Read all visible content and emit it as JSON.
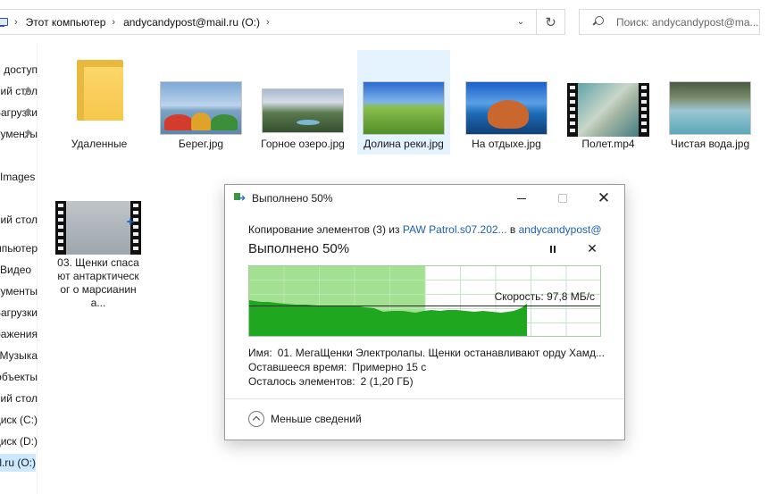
{
  "address": {
    "crumbs": [
      "Этот компьютер",
      "andycandypost@mail.ru (O:)"
    ],
    "search_placeholder": "Поиск: andycandypost@ma..."
  },
  "nav": {
    "items": [
      {
        "label": "Быстрый доступ"
      },
      {
        "label": "Рабочий стол"
      },
      {
        "label": "Загрузки"
      },
      {
        "label": "Документы"
      },
      {
        "label": "Images"
      },
      {
        "label": "Рабочий стол"
      },
      {
        "label": "Этот компьютер"
      },
      {
        "label": "Видео"
      },
      {
        "label": "Документы"
      },
      {
        "label": "Загрузки"
      },
      {
        "label": "Изображения"
      },
      {
        "label": "Музыка"
      },
      {
        "label": "Объемные объекты"
      },
      {
        "label": "Рабочий стол"
      },
      {
        "label": "Локальный диск (C:)"
      },
      {
        "label": "Локальный диск (D:)"
      },
      {
        "label": "andycandypost@mail.ru (O:)"
      }
    ]
  },
  "files": [
    {
      "name": "Удаленные",
      "kind": "folder-icon"
    },
    {
      "name": "Берег.jpg",
      "kind": "image"
    },
    {
      "name": "Горное озеро.jpg",
      "kind": "image"
    },
    {
      "name": "Долина реки.jpg",
      "kind": "image"
    },
    {
      "name": "На отдыхе.jpg",
      "kind": "image"
    },
    {
      "name": "Полет.mp4",
      "kind": "video"
    },
    {
      "name": "Чистая вода.jpg",
      "kind": "image"
    },
    {
      "name": "03. Щенки спасают антарктическог о марсианина...",
      "kind": "video"
    }
  ],
  "dialog": {
    "title": "Выполнено 50%",
    "copy_prefix": "Копирование элементов (3) из",
    "source": "PAW Patrol.s07.202...",
    "copy_in": "в",
    "destination": "andycandypost@...",
    "percent_label": "Выполнено 50%",
    "progress": 0.5,
    "speed_label": "Скорость: 97,8 МБ/с",
    "name_key": "Имя:",
    "name_value": "01. МегаЩенки Электролапы. Щенки останавливают орду Хамд...",
    "time_key": "Оставшееся время:",
    "time_value": "Примерно 15 с",
    "items_key": "Осталось элементов:",
    "items_value": "2 (1,20 ГБ)",
    "less_details": "Меньше сведений"
  },
  "colors": {
    "accent_link": "#1a5fb4",
    "progress_fill": "#86d66e",
    "graph_area": "#1fa81f",
    "selection": "#e5f3ff"
  }
}
